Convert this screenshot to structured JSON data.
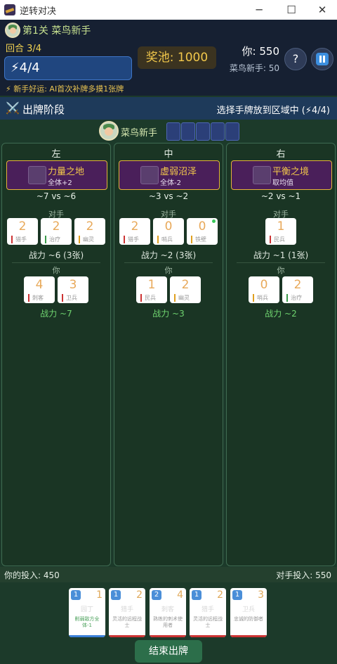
{
  "window": {
    "title": "逆转对决",
    "min": "─",
    "max": "☐",
    "close": "✕"
  },
  "header": {
    "stage": "第1关 菜鸟新手",
    "round": "回合 3/4",
    "energy": "⚡4/4",
    "tip": "⚡ 新手好运: AI首次补牌多摸1张牌",
    "pool": "奖池: 1000",
    "you_score": "你: 550",
    "opp_score": "菜鸟新手: 50",
    "help": "?"
  },
  "phase": {
    "icon": "⚔️",
    "label": "出牌阶段",
    "hint": "选择手牌放到区域中 (⚡4/4)"
  },
  "opponent": {
    "name": "菜鸟新手"
  },
  "lanes": [
    {
      "title": "左",
      "loc_name": "力量之地",
      "loc_effect": "全体+2",
      "vs": "~7 vs ~6",
      "opp_label": "对手",
      "opp_cards": [
        {
          "v": "2",
          "lab": "猎手",
          "c": "red"
        },
        {
          "v": "2",
          "lab": "治疗",
          "c": "green"
        },
        {
          "v": "2",
          "lab": "幽灵",
          "c": "yellow"
        }
      ],
      "opp_power": "战力 ~6 (3张)",
      "me_label": "你",
      "me_cards": [
        {
          "v": "4",
          "lab": "刺客",
          "c": "red"
        },
        {
          "v": "3",
          "lab": "卫兵",
          "c": "red"
        }
      ],
      "me_power": "战力 ~7"
    },
    {
      "title": "中",
      "loc_name": "虚弱沼泽",
      "loc_effect": "全体-2",
      "vs": "~3 vs ~2",
      "opp_label": "对手",
      "opp_cards": [
        {
          "v": "2",
          "lab": "猎手",
          "c": "red"
        },
        {
          "v": "0",
          "lab": "哨兵",
          "c": "yellow"
        },
        {
          "v": "0",
          "lab": "铁壁",
          "c": "yellow",
          "dot": true
        }
      ],
      "opp_power": "战力 ~2 (3张)",
      "me_label": "你",
      "me_cards": [
        {
          "v": "1",
          "lab": "民兵",
          "c": "red"
        },
        {
          "v": "2",
          "lab": "幽灵",
          "c": "yellow"
        }
      ],
      "me_power": "战力 ~3"
    },
    {
      "title": "右",
      "loc_name": "平衡之境",
      "loc_effect": "取均值",
      "vs": "~2 vs ~1",
      "opp_label": "对手",
      "opp_cards": [
        {
          "v": "1",
          "lab": "民兵",
          "c": "red"
        }
      ],
      "opp_power": "战力 ~1 (1张)",
      "me_label": "你",
      "me_cards": [
        {
          "v": "0",
          "lab": "哨兵",
          "c": "yellow"
        },
        {
          "v": "2",
          "lab": "治疗",
          "c": "green"
        }
      ],
      "me_power": "战力 ~2"
    }
  ],
  "bottom": {
    "my_invest": "你的投入: 450",
    "opp_invest": "对手投入: 550",
    "end_button": "结束出牌"
  },
  "hand": [
    {
      "cost": "1",
      "power": "1",
      "name": "园丁",
      "desc": "削弱敌方全体-1",
      "desc_green": true,
      "bar": "blue"
    },
    {
      "cost": "1",
      "power": "2",
      "name": "猎手",
      "desc": "灵活的远程战士",
      "desc_green": false,
      "bar": "red"
    },
    {
      "cost": "2",
      "power": "4",
      "name": "刺客",
      "desc": "熟练的刺术使用者",
      "desc_green": false,
      "bar": "red"
    },
    {
      "cost": "1",
      "power": "2",
      "name": "猎手",
      "desc": "灵活的远程战士",
      "desc_green": false,
      "bar": "red"
    },
    {
      "cost": "1",
      "power": "3",
      "name": "卫兵",
      "desc": "忠诚的防御者",
      "desc_green": false,
      "bar": "red"
    }
  ]
}
